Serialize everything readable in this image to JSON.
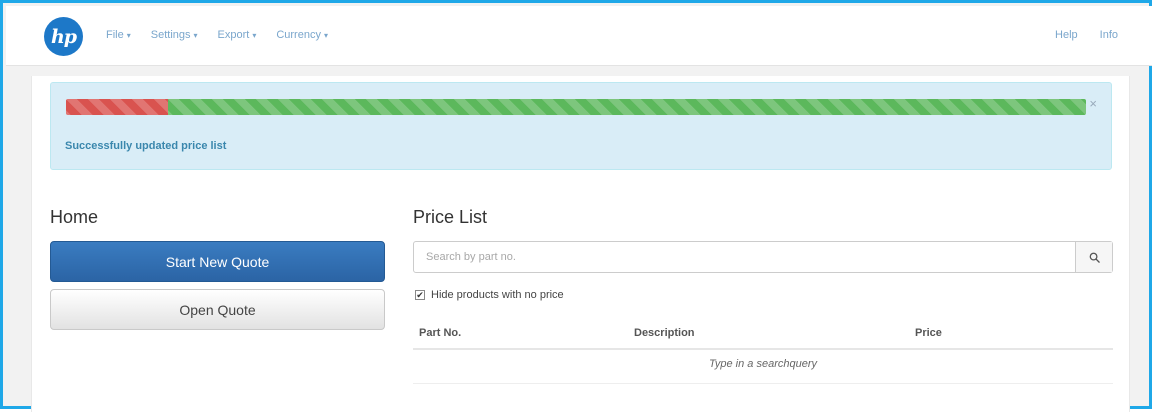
{
  "navbar": {
    "logo_text": "hp",
    "menu": [
      {
        "label": "File",
        "caret": "▾"
      },
      {
        "label": "Settings",
        "caret": "▾"
      },
      {
        "label": "Export",
        "caret": "▾"
      },
      {
        "label": "Currency",
        "caret": "▾"
      }
    ],
    "right": {
      "help": "Help",
      "info": "Info"
    }
  },
  "alert": {
    "progress": {
      "failed_fraction": 0.1,
      "succeeded_fraction": 0.9
    },
    "close_glyph": "×",
    "message": "Successfully updated price list"
  },
  "home": {
    "title": "Home",
    "start_new_quote": "Start New Quote",
    "open_quote": "Open Quote"
  },
  "price_list": {
    "title": "Price List",
    "search_placeholder": "Search by part no.",
    "search_icon": "search-icon",
    "hide_no_price": {
      "label": "Hide products with no price",
      "checked": true
    },
    "columns": [
      "Part No.",
      "Description",
      "Price"
    ],
    "empty_message": "Type in a searchquery"
  },
  "colors": {
    "frame_border": "#1fa8e8",
    "primary": "#2b64a5",
    "alert_bg": "#d9edf7",
    "progress_red": "#d9534f",
    "progress_green": "#5cb85c",
    "logo": "#1d78c8"
  }
}
